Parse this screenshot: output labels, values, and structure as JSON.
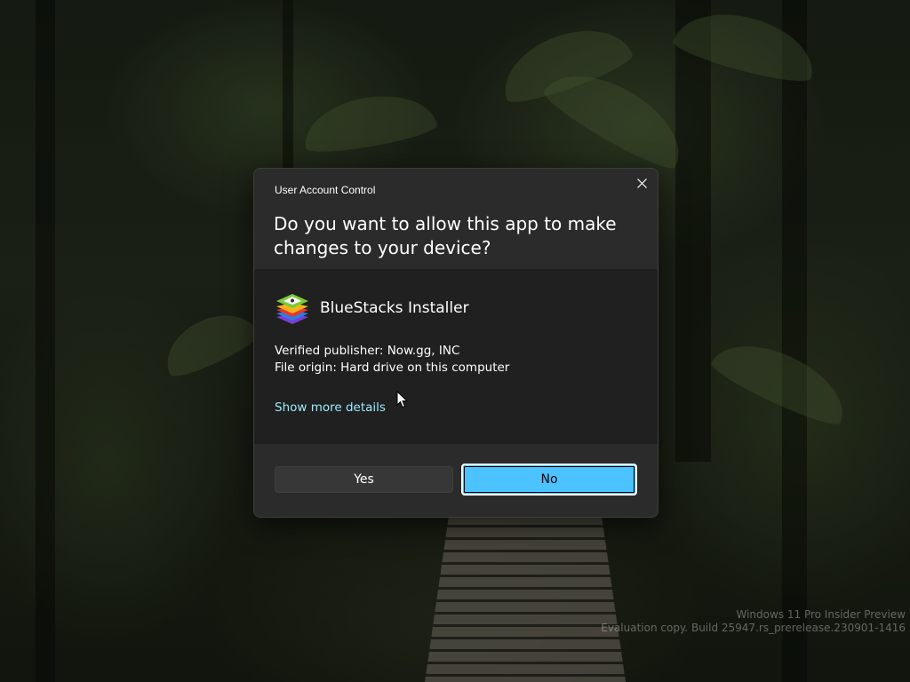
{
  "desktop": {
    "watermark_line1": "Windows 11 Pro Insider Preview",
    "watermark_line2": "Evaluation copy. Build 25947.rs_prerelease.230901-1416"
  },
  "dialog": {
    "title": "User Account Control",
    "question": "Do you want to allow this app to make changes to your device?",
    "app_name": "BlueStacks Installer",
    "app_icon": "bluestacks-icon",
    "verified_publisher": "Verified publisher: Now.gg, INC",
    "file_origin": "File origin: Hard drive on this computer",
    "show_more_details": "Show more details",
    "yes_label": "Yes",
    "no_label": "No",
    "close_icon": "close-icon"
  },
  "colors": {
    "accent": "#4cc2ff",
    "link": "#99ebff",
    "dialog_header": "#2b2b2b",
    "dialog_body": "#202020"
  }
}
